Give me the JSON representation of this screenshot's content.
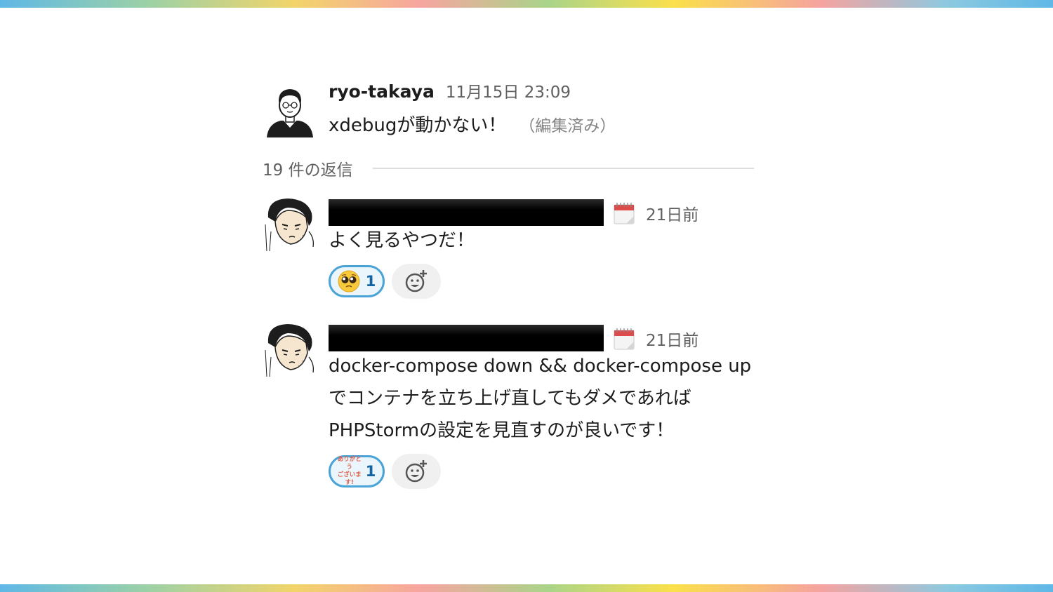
{
  "parent": {
    "author": "ryo-takaya",
    "timestamp": "11月15日 23:09",
    "text": "xdebugが動かない！",
    "edited": "（編集済み）"
  },
  "replies_label": "19 件の返信",
  "replies": [
    {
      "time": "21日前",
      "lines": [
        "よく見るやつだ！"
      ],
      "reaction": {
        "emoji": "pleading-face-emoji",
        "count": "1"
      }
    },
    {
      "time": "21日前",
      "lines": [
        "docker-compose down && docker-compose up",
        "でコンテナを立ち上げ直してもダメであれば",
        "PHPStormの設定を見直すのが良いです！"
      ],
      "reaction": {
        "emoji": "arigatou-gozaimasu-emoji",
        "label_top": "ありがとう",
        "label_bottom": "ございます!",
        "count": "1"
      }
    }
  ],
  "colors": {
    "reaction_border": "#4aa3d6",
    "reaction_count": "#1264a3"
  }
}
